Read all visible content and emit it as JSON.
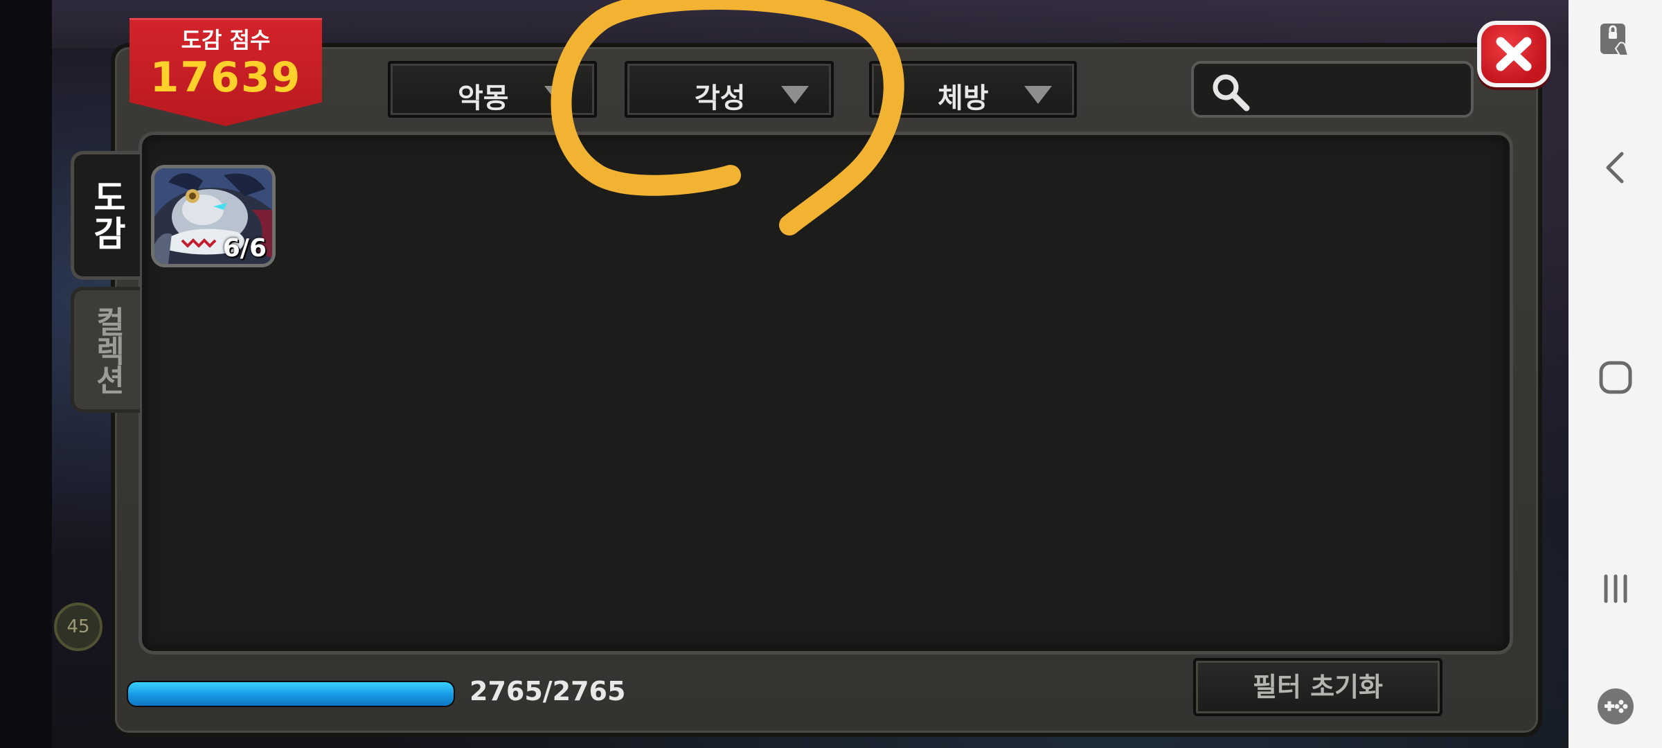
{
  "score": {
    "label": "도감 점수",
    "value": "17639"
  },
  "filters": [
    {
      "label": "악몽"
    },
    {
      "label": "각성"
    },
    {
      "label": "체방"
    }
  ],
  "search": {
    "value": "",
    "placeholder": ""
  },
  "tabs": {
    "dogam": "도감",
    "collection": "컬렉션"
  },
  "cards": [
    {
      "count": "6/6"
    }
  ],
  "progress": {
    "text": "2765/2765",
    "fraction": 1.0,
    "color": "#1f9ae6"
  },
  "buttons": {
    "reset": "필터 초기화"
  },
  "colors": {
    "ribbon": "#c91c22",
    "score_value": "#ffd12a",
    "annotation": "#f2b232",
    "close": "#d4191f"
  },
  "nav": {
    "icons": [
      "touch-lock-icon",
      "back-icon",
      "home-icon",
      "recents-icon",
      "game-tools-icon"
    ]
  }
}
